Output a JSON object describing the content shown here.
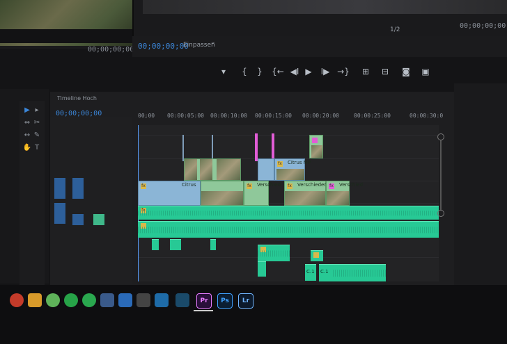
{
  "monitor": {
    "program_timecode": "00;00;00;00",
    "fit_label": "Einpassen",
    "fit_chevron": "⌄",
    "zoom_label": "1/2",
    "program_end_tc": "00;00;00;00",
    "source_tc": "00;00;00;00"
  },
  "transport": {
    "buttons": [
      {
        "name": "mark-in-icon",
        "glyph": "▾"
      },
      {
        "name": "in-bracket-icon",
        "glyph": "{"
      },
      {
        "name": "out-bracket-icon",
        "glyph": "}"
      },
      {
        "name": "go-to-in-icon",
        "glyph": "{←"
      },
      {
        "name": "step-back-icon",
        "glyph": "◀I"
      },
      {
        "name": "play-icon",
        "glyph": "▶"
      },
      {
        "name": "step-forward-icon",
        "glyph": "I▶"
      },
      {
        "name": "go-to-out-icon",
        "glyph": "→}"
      },
      {
        "name": "lift-icon",
        "glyph": "⊞"
      },
      {
        "name": "extract-icon",
        "glyph": "⊟"
      },
      {
        "name": "export-frame-icon",
        "glyph": "◙"
      },
      {
        "name": "compare-icon",
        "glyph": "▣"
      }
    ]
  },
  "timeline": {
    "sequence_name": "Timeline Hoch",
    "sequence_tc": "00;00;00;00",
    "ruler": [
      "00;00",
      "00:00:05:00",
      "00:00:10:00",
      "00:00:15:00",
      "00:00:20:00",
      "00:00:25:00",
      "00:00:30:0"
    ],
    "clips": [
      {
        "label": "Citrus",
        "fx": "fx"
      },
      {
        "label": "Citrus",
        "fx": "fx"
      },
      {
        "label": "Verschied",
        "fx": "fx"
      },
      {
        "label": "Citrus MP",
        "fx": "fx"
      },
      {
        "label": "Verschiedene",
        "fx": "fx"
      },
      {
        "label": "Verschied",
        "fx": "fx"
      }
    ],
    "audio_fx": "fx",
    "audio_clip_labels": [
      "C.1",
      "C.1"
    ]
  },
  "taskbar": {
    "apps": [
      {
        "name": "premiere-icon",
        "label": "Pr",
        "color": "#e77bff",
        "bg": "#2a0f3a"
      },
      {
        "name": "photoshop-icon",
        "label": "Ps",
        "color": "#3ea0ff",
        "bg": "#0b1e33"
      },
      {
        "name": "lightroom-icon",
        "label": "Lr",
        "color": "#6fb4ff",
        "bg": "#0c1a2c"
      }
    ]
  },
  "colors": {
    "accent_blue": "#3b86d8",
    "audio_green": "#27c995",
    "marker_pink": "#e15cd6",
    "workarea_yellow": "#d8cf3a"
  }
}
